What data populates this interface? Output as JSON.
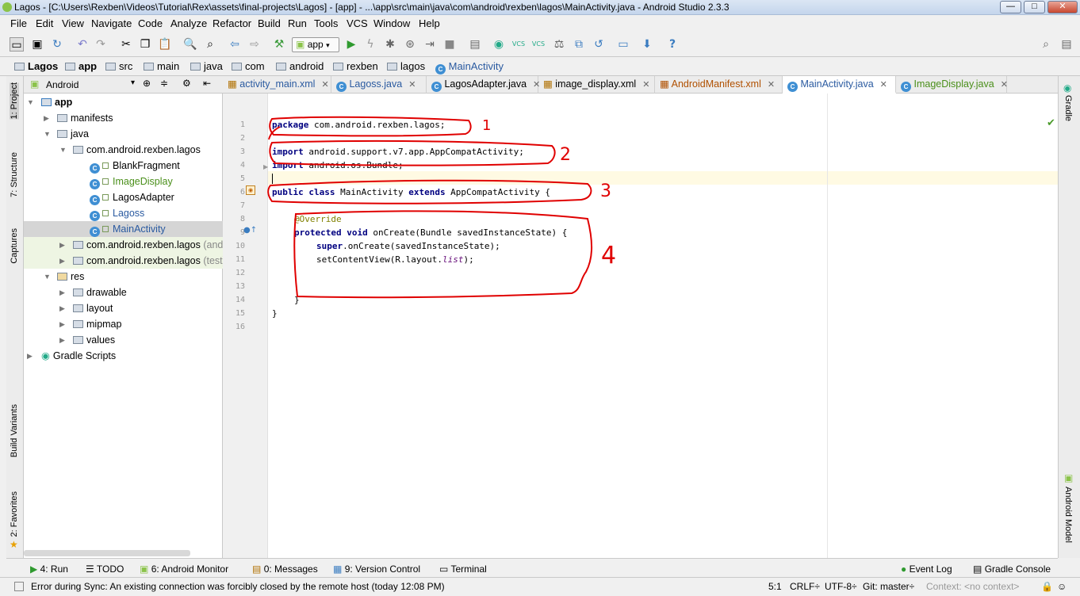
{
  "window": {
    "title": "Lagos - [C:\\Users\\Rexben\\Videos\\Tutorial\\Rex\\assets\\final-projects\\Lagos] - [app] - ...\\app\\src\\main\\java\\com\\android\\rexben\\lagos\\MainActivity.java - Android Studio 2.3.3",
    "minimize": "—",
    "maximize": "□",
    "close": "✕"
  },
  "menu": [
    "File",
    "Edit",
    "View",
    "Navigate",
    "Code",
    "Analyze",
    "Refactor",
    "Build",
    "Run",
    "Tools",
    "VCS",
    "Window",
    "Help"
  ],
  "toolbar": {
    "run_config": "app",
    "vcs1": "VCS",
    "vcs2": "VCS",
    "help": "?"
  },
  "breadcrumbs": [
    "Lagos",
    "app",
    "src",
    "main",
    "java",
    "com",
    "android",
    "rexben",
    "lagos",
    "MainActivity"
  ],
  "project_panel": {
    "view": "Android"
  },
  "tree": [
    {
      "label": "app"
    },
    {
      "label": "manifests"
    },
    {
      "label": "java"
    },
    {
      "label": "com.android.rexben.lagos"
    },
    {
      "label": "BlankFragment"
    },
    {
      "label": "ImageDisplay"
    },
    {
      "label": "LagosAdapter"
    },
    {
      "label": "Lagoss"
    },
    {
      "label": "MainActivity"
    },
    {
      "label": "com.android.rexben.lagos",
      "suffix": "(andr"
    },
    {
      "label": "com.android.rexben.lagos",
      "suffix": "(test)"
    },
    {
      "label": "res"
    },
    {
      "label": "drawable"
    },
    {
      "label": "layout"
    },
    {
      "label": "mipmap"
    },
    {
      "label": "values"
    },
    {
      "label": "Gradle Scripts"
    }
  ],
  "tabs": [
    {
      "label": "activity_main.xml"
    },
    {
      "label": "Lagoss.java"
    },
    {
      "label": "LagosAdapter.java"
    },
    {
      "label": "image_display.xml"
    },
    {
      "label": "AndroidManifest.xml"
    },
    {
      "label": "MainActivity.java"
    },
    {
      "label": "ImageDisplay.java"
    }
  ],
  "code": {
    "line_numbers": [
      "1",
      "2",
      "3",
      "4",
      "5",
      "6",
      "7",
      "8",
      "9",
      "10",
      "11",
      "12",
      "13",
      "14",
      "15",
      "16"
    ],
    "l1_kw": "package",
    "l1_rest": " com.android.rexben.lagos;",
    "l3_kw": "import",
    "l3_rest": " android.support.v7.app.AppCompatActivity;",
    "l4_kw": "import",
    "l4_rest": " android.os.Bundle;",
    "l6_kw1": "public class",
    "l6_a": " MainActivity ",
    "l6_kw2": "extends",
    "l6_b": " AppCompatActivity {",
    "l8": "@Override",
    "l9_kw": "protected void",
    "l9_rest": " onCreate(Bundle savedInstanceState) {",
    "l10_kw": "super",
    "l10_rest": ".onCreate(savedInstanceState);",
    "l11_a": "setContentView(R.layout.",
    "l11_it": "list",
    "l11_b": ");",
    "l14": "}",
    "l15": "}"
  },
  "annotations": [
    "1",
    "2",
    "3",
    "4"
  ],
  "side_tools_left": [
    "1: Project",
    "7: Structure",
    "Captures",
    "Build Variants",
    "2: Favorites"
  ],
  "side_tools_right": [
    "Gradle",
    "Android Model"
  ],
  "bottom_tools": [
    "4: Run",
    "TODO",
    "6: Android Monitor",
    "0: Messages",
    "9: Version Control",
    "Terminal",
    "Event Log",
    "Gradle Console"
  ],
  "status": {
    "message": "Error during Sync: An existing connection was forcibly closed by the remote host (today 12:08 PM)",
    "position": "5:1",
    "line_sep": "CRLF÷",
    "encoding": "UTF-8÷",
    "git": "Git: master÷",
    "context": "Context: <no context>"
  }
}
